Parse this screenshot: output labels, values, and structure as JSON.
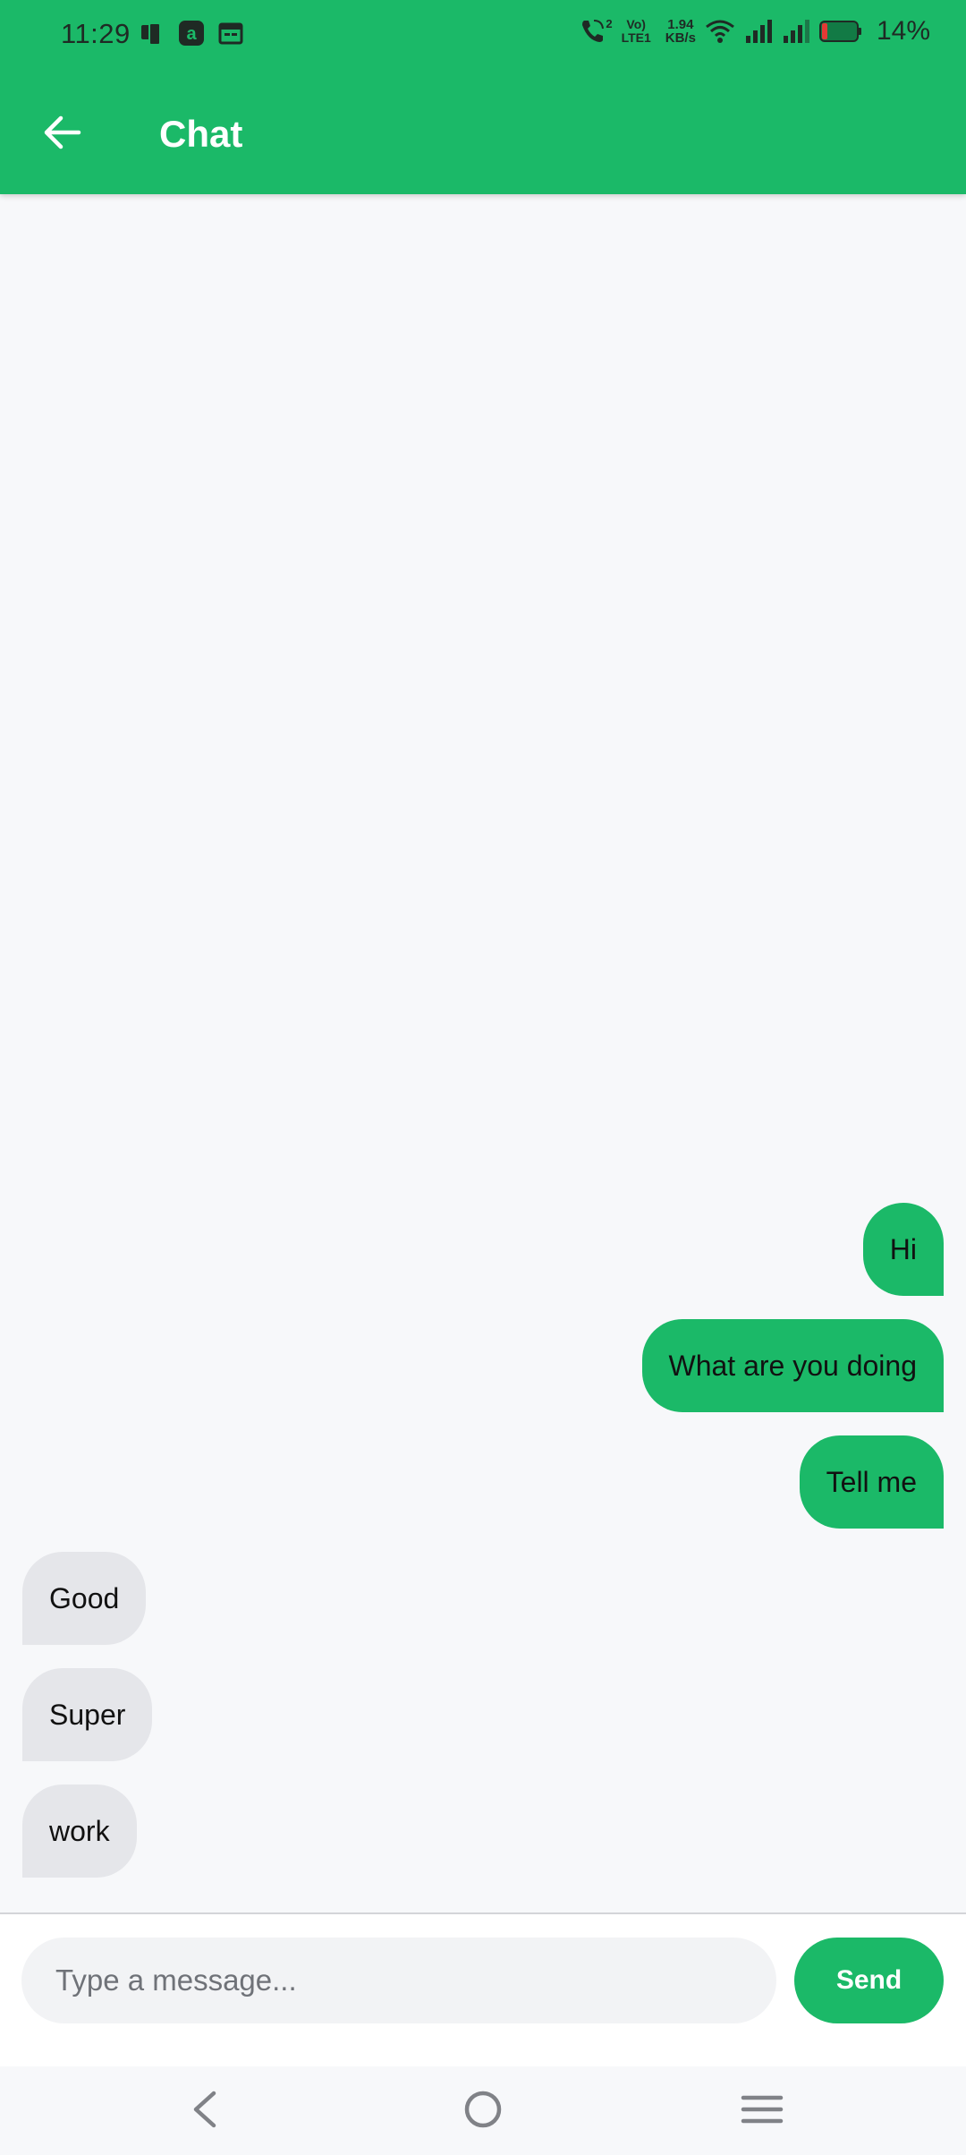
{
  "status_bar": {
    "time": "11:29",
    "network_speed_value": "1.94",
    "network_speed_unit": "KB/s",
    "volte_line1": "Vo)",
    "volte_line2": "LTE1",
    "call_sim": "2",
    "battery_percent": "14%",
    "icons": [
      "phone-screen-icon",
      "app-a-icon",
      "calendar-icon",
      "wifi-call-icon",
      "wifi-icon",
      "signal-icon",
      "signal-icon-2",
      "battery-low-icon"
    ]
  },
  "app_bar": {
    "title": "Chat",
    "back_icon": "arrow-left-icon"
  },
  "messages": [
    {
      "text": "Hi",
      "direction": "outgoing"
    },
    {
      "text": "What are you doing",
      "direction": "outgoing"
    },
    {
      "text": "Tell me",
      "direction": "outgoing"
    },
    {
      "text": "Good",
      "direction": "incoming"
    },
    {
      "text": "Super",
      "direction": "incoming"
    },
    {
      "text": "work",
      "direction": "incoming"
    }
  ],
  "composer": {
    "placeholder": "Type a message...",
    "value": "",
    "send_label": "Send"
  },
  "nav_bar": {
    "icons": [
      "nav-back-icon",
      "nav-home-icon",
      "nav-menu-icon"
    ]
  },
  "colors": {
    "primary": "#1bb968",
    "incoming_bubble": "#e5e6ea",
    "background": "#f7f8fa"
  }
}
